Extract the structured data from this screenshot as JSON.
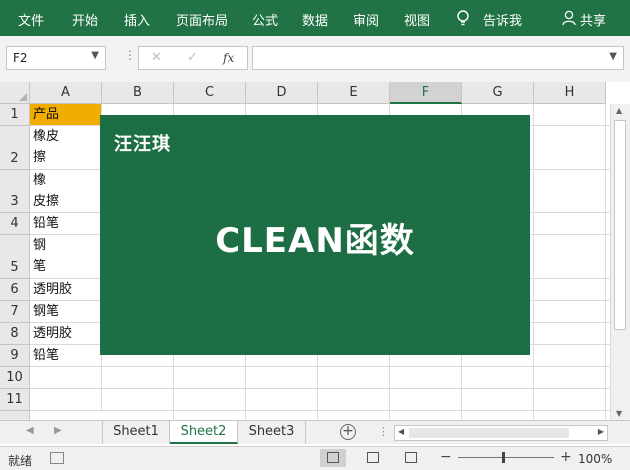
{
  "ribbon": {
    "tabs": [
      "文件",
      "开始",
      "插入",
      "页面布局",
      "公式",
      "数据",
      "审阅",
      "视图"
    ],
    "tellme": "告诉我",
    "share": "共享"
  },
  "formula_bar": {
    "name_box": "F2",
    "fx": "fx",
    "cancel": "✕",
    "confirm": "✓",
    "content": ""
  },
  "columns": [
    "A",
    "B",
    "C",
    "D",
    "E",
    "F",
    "G",
    "H"
  ],
  "rows": [
    "1",
    "2",
    "3",
    "4",
    "5",
    "6",
    "7",
    "8",
    "9",
    "10",
    "11"
  ],
  "column_a": [
    [
      "产品"
    ],
    [
      "橡皮",
      "擦"
    ],
    [
      "橡",
      "皮擦"
    ],
    [
      "铅笔"
    ],
    [
      "钢",
      "笔"
    ],
    [
      "透明胶"
    ],
    [
      "钢笔"
    ],
    [
      "透明胶"
    ],
    [
      "铅笔"
    ],
    [],
    []
  ],
  "banner": {
    "author": "汪汪琪",
    "title": "CLEAN函数"
  },
  "sheets": [
    "Sheet1",
    "Sheet2",
    "Sheet3"
  ],
  "active_sheet": "Sheet2",
  "status": {
    "ready": "就绪",
    "zoom": "100%"
  },
  "colors": {
    "ribbon": "#217346",
    "banner": "#1e6e45",
    "header_cell": "#f0ad00"
  }
}
